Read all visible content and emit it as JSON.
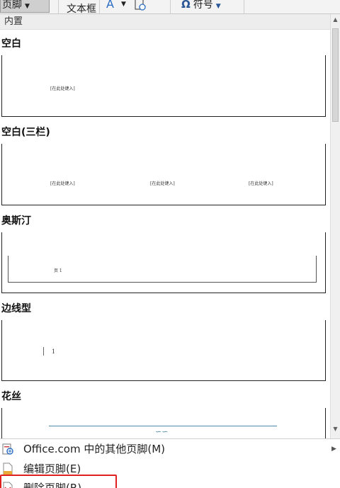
{
  "ribbon": {
    "footer_label": "页脚",
    "textbox_label": "文本框",
    "symbol_glyph": "Ω",
    "symbol_label": "符号",
    "dropdown_glyph": "⌄"
  },
  "gallery": {
    "section_header": "内置",
    "templates": [
      {
        "title": "空白",
        "placeholders": [
          "[在此处键入]"
        ]
      },
      {
        "title": "空白(三栏)",
        "placeholders": [
          "[在此处键入]",
          "[在此处键入]",
          "[在此处键入]"
        ]
      },
      {
        "title": "奥斯汀",
        "page_number": "页 1"
      },
      {
        "title": "边线型",
        "page_number": "1"
      },
      {
        "title": "花丝",
        "ornament": "∽∽"
      }
    ]
  },
  "menu": {
    "items": [
      {
        "label": "Office.com 中的其他页脚(M)",
        "icon": "office-online-icon",
        "has_submenu": true
      },
      {
        "label": "编辑页脚(E)",
        "icon": "edit-footer-icon"
      },
      {
        "label": "删除页脚(R)",
        "icon": "remove-footer-icon"
      }
    ]
  },
  "colors": {
    "highlight_box": "#e02020",
    "accent_blue": "#2b6cc4",
    "ornament_line": "#4a8aa8"
  }
}
